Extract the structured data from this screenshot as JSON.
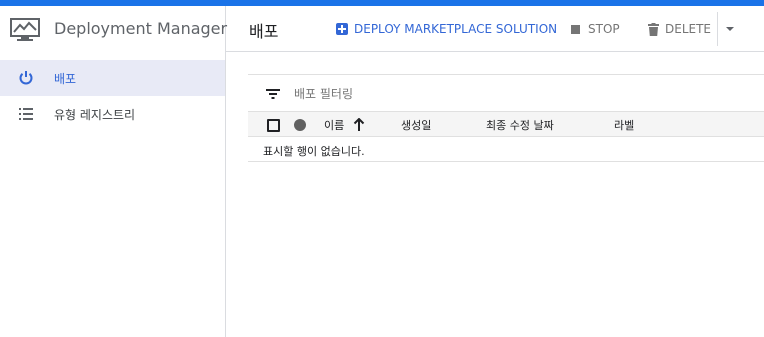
{
  "app": {
    "title": "Deployment Manager",
    "accent": "#1a73e8",
    "active_color": "#3367d6"
  },
  "sidebar": {
    "items": [
      {
        "label": "배포",
        "icon": "power-icon",
        "active": true
      },
      {
        "label": "유형 레지스트리",
        "icon": "list-icon",
        "active": false
      }
    ]
  },
  "header": {
    "title": "배포",
    "deploy_label": "DEPLOY MARKETPLACE SOLUTION",
    "stop_label": "STOP",
    "delete_label": "DELETE"
  },
  "filter": {
    "placeholder": "배포 필터링"
  },
  "table": {
    "columns": [
      "이름",
      "생성일",
      "최종 수정 날짜",
      "라벨"
    ],
    "sort_column": "이름",
    "sort_direction": "ascending",
    "empty_message": "표시할 행이 없습니다."
  }
}
